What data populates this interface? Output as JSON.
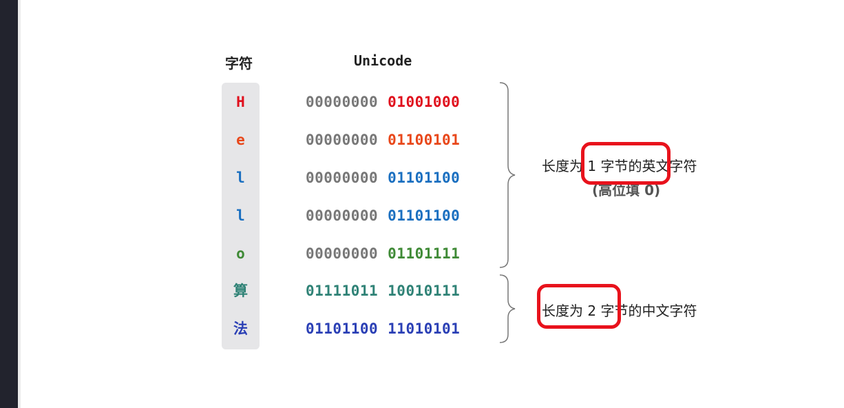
{
  "headers": {
    "char": "字符",
    "code": "Unicode"
  },
  "rows": [
    {
      "char": "H",
      "high": "00000000",
      "low": "01001000",
      "color": "#e0101d",
      "high_color": "#777777"
    },
    {
      "char": "e",
      "high": "00000000",
      "low": "01100101",
      "color": "#e8471a",
      "high_color": "#777777"
    },
    {
      "char": "l",
      "high": "00000000",
      "low": "01101100",
      "color": "#1a6fc0",
      "high_color": "#777777"
    },
    {
      "char": "l",
      "high": "00000000",
      "low": "01101100",
      "color": "#1a6fc0",
      "high_color": "#777777"
    },
    {
      "char": "o",
      "high": "00000000",
      "low": "01101111",
      "color": "#3f8a36",
      "high_color": "#777777"
    },
    {
      "char": "算",
      "high": "01111011",
      "low": "10010111",
      "color": "#2f8276",
      "high_color": "#2f8276"
    },
    {
      "char": "法",
      "high": "01101100",
      "low": "11010101",
      "color": "#2a3fb5",
      "high_color": "#2a3fb5"
    }
  ],
  "labels": {
    "english": "长度为 1 字节的英文字符",
    "english_note": "(高位填 0)",
    "chinese": "长度为 2 字节的中文字符"
  }
}
